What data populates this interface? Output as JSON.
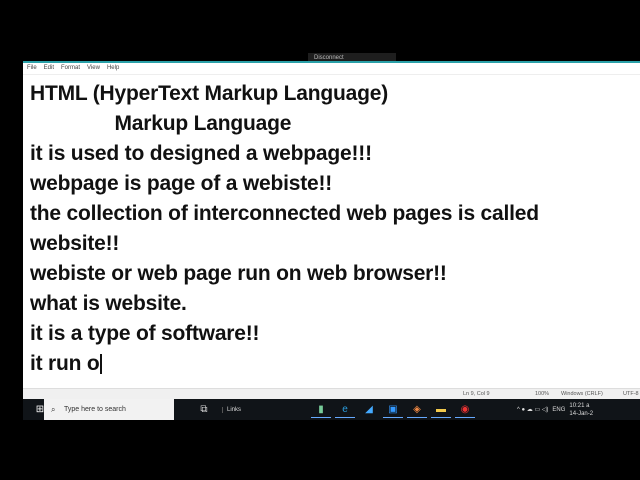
{
  "remote_toolbar": {
    "label": "Disconnect"
  },
  "menu": [
    "File",
    "Edit",
    "Format",
    "View",
    "Help"
  ],
  "editor_lines": [
    "HTML (HyperText Markup Language)",
    "               Markup Language",
    "it is used to designed a webpage!!!",
    "webpage is page of a webiste!!",
    "the collection of interconnected web pages is called",
    "website!!",
    "webiste or web page run on web browser!!",
    "what is website.",
    "it is a type of software!!",
    "it run o"
  ],
  "status": {
    "position": "Ln 9, Col 9",
    "zoom": "100%",
    "line_ending": "Windows (CRLF)",
    "encoding": "UTF-8"
  },
  "taskbar": {
    "search_placeholder": "Type here to search",
    "links_label": "Links",
    "time": "10:21 a",
    "date": "14-Jan-2",
    "lang": "ENG"
  }
}
